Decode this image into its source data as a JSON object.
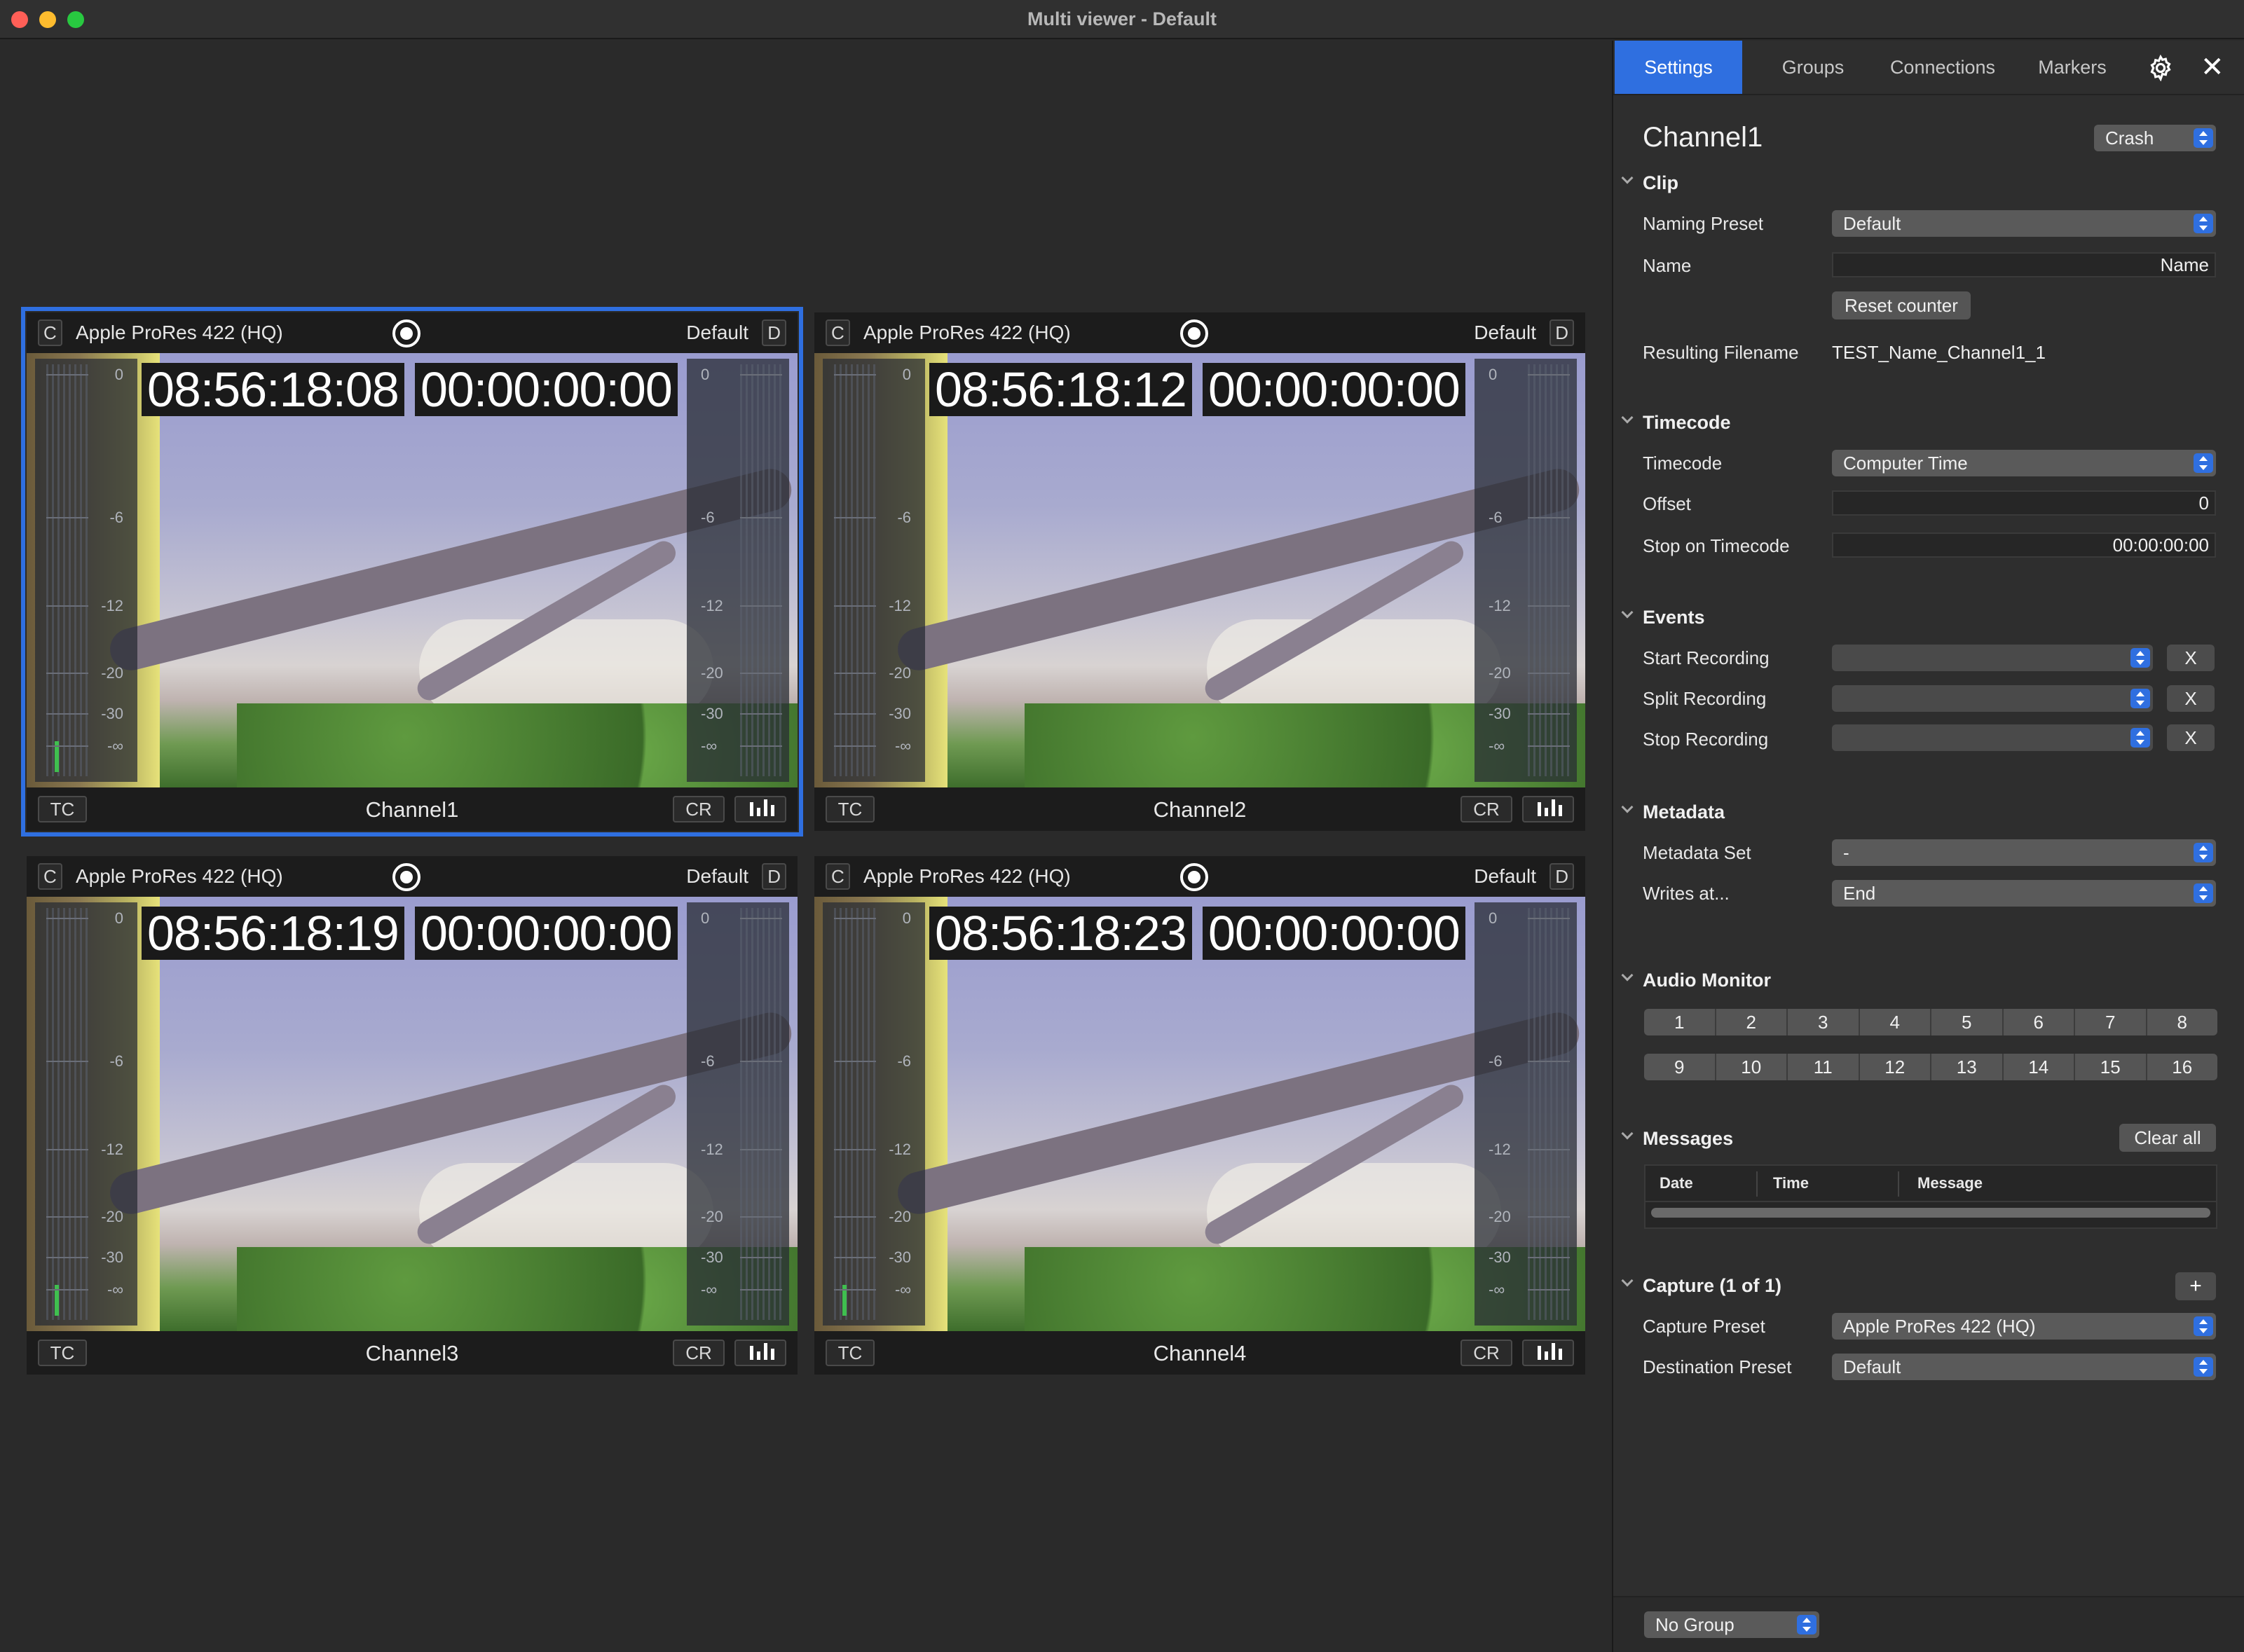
{
  "window": {
    "title": "Multi viewer - Default"
  },
  "tiles": [
    {
      "codec": "Apple ProRes 422 (HQ)",
      "preset": "Default",
      "tc_live": "08:56:18:08",
      "tc_rec": "00:00:00:00",
      "channel": "Channel1",
      "c_label": "C",
      "d_label": "D",
      "tc_label": "TC",
      "cr_label": "CR"
    },
    {
      "codec": "Apple ProRes 422 (HQ)",
      "preset": "Default",
      "tc_live": "08:56:18:12",
      "tc_rec": "00:00:00:00",
      "channel": "Channel2",
      "c_label": "C",
      "d_label": "D",
      "tc_label": "TC",
      "cr_label": "CR"
    },
    {
      "codec": "Apple ProRes 422 (HQ)",
      "preset": "Default",
      "tc_live": "08:56:18:19",
      "tc_rec": "00:00:00:00",
      "channel": "Channel3",
      "c_label": "C",
      "d_label": "D",
      "tc_label": "TC",
      "cr_label": "CR"
    },
    {
      "codec": "Apple ProRes 422 (HQ)",
      "preset": "Default",
      "tc_live": "08:56:18:23",
      "tc_rec": "00:00:00:00",
      "channel": "Channel4",
      "c_label": "C",
      "d_label": "D",
      "tc_label": "TC",
      "cr_label": "CR"
    }
  ],
  "meter_ticks": [
    "0",
    "-6",
    "-12",
    "-20",
    "-30",
    "-∞"
  ],
  "panel": {
    "tabs": [
      "Settings",
      "Groups",
      "Connections",
      "Markers"
    ],
    "channel_title": "Channel1",
    "status_select": "Crash",
    "clip": {
      "heading": "Clip",
      "naming_preset_label": "Naming Preset",
      "naming_preset_value": "Default",
      "name_label": "Name",
      "name_value": "Name",
      "reset_counter": "Reset counter",
      "resulting_filename_label": "Resulting Filename",
      "resulting_filename_value": "TEST_Name_Channel1_1"
    },
    "timecode": {
      "heading": "Timecode",
      "timecode_label": "Timecode",
      "timecode_value": "Computer Time",
      "offset_label": "Offset",
      "offset_value": "0",
      "stop_label": "Stop on Timecode",
      "stop_value": "00:00:00:00"
    },
    "events": {
      "heading": "Events",
      "start_label": "Start Recording",
      "split_label": "Split Recording",
      "stop_label": "Stop Recording",
      "x_label": "X"
    },
    "metadata": {
      "heading": "Metadata",
      "set_label": "Metadata Set",
      "set_value": "-",
      "writes_label": "Writes at...",
      "writes_value": "End"
    },
    "audio": {
      "heading": "Audio Monitor",
      "row1": [
        "1",
        "2",
        "3",
        "4",
        "5",
        "6",
        "7",
        "8"
      ],
      "row2": [
        "9",
        "10",
        "11",
        "12",
        "13",
        "14",
        "15",
        "16"
      ]
    },
    "messages": {
      "heading": "Messages",
      "clear_all": "Clear all",
      "columns": [
        "Date",
        "Time",
        "Message"
      ]
    },
    "capture": {
      "heading": "Capture (1 of 1)",
      "add": "+",
      "capture_preset_label": "Capture Preset",
      "capture_preset_value": "Apple ProRes 422 (HQ)",
      "destination_label": "Destination Preset",
      "destination_value": "Default"
    },
    "group_select": "No Group"
  },
  "colors": {
    "accent": "#2f6fe0",
    "meter_level": "#3fbf4f"
  }
}
